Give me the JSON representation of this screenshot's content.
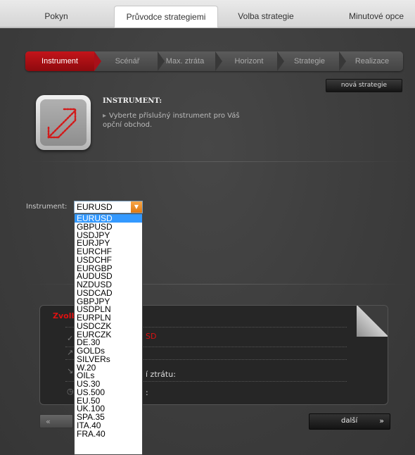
{
  "tabs": [
    {
      "label": "Pokyn"
    },
    {
      "label": "Průvodce strategiemi"
    },
    {
      "label": "Volba strategie"
    },
    {
      "label": "Minutové opce"
    }
  ],
  "active_tab": "Průvodce strategiemi",
  "steps": [
    {
      "label": "Instrument"
    },
    {
      "label": "Scénář"
    },
    {
      "label": "Max. ztráta"
    },
    {
      "label": "Horizont"
    },
    {
      "label": "Strategie"
    },
    {
      "label": "Realizace"
    }
  ],
  "new_strategy_label": "nová strategie",
  "icon": "diagonal-arrow-icon",
  "intro": {
    "heading": "INSTRUMENT:",
    "description": "Vyberte příslušný instrument pro Váš opční obchod."
  },
  "instrument_label": "Instrument:",
  "instrument_selected": "EURUSD",
  "instrument_options": [
    "EURUSD",
    "GBPUSD",
    "USDJPY",
    "EURJPY",
    "EURCHF",
    "USDCHF",
    "EURGBP",
    "AUDUSD",
    "NZDUSD",
    "USDCAD",
    "GBPJPY",
    "USDPLN",
    "EURPLN",
    "USDCZK",
    "EURCZK",
    "DE.30",
    "GOLDs",
    "SILVERs",
    "W.20",
    "OILs",
    "US.30",
    "US.500",
    "EU.50",
    "UK.100",
    "SPA.35",
    "ITA.40",
    "FRA.40"
  ],
  "summary": {
    "title_partial": "Zvolb",
    "instrument_value_partial": "SD",
    "max_loss_partial": "í ztrátu:",
    "horizon_partial": ":"
  },
  "nav": {
    "back_label": "«",
    "next_label": "další",
    "next_chevron": "»"
  },
  "colors": {
    "accent_red": "#c4141a",
    "highlight_blue": "#3399ff",
    "dropdown_arrow_orange": "#f28c1c"
  }
}
